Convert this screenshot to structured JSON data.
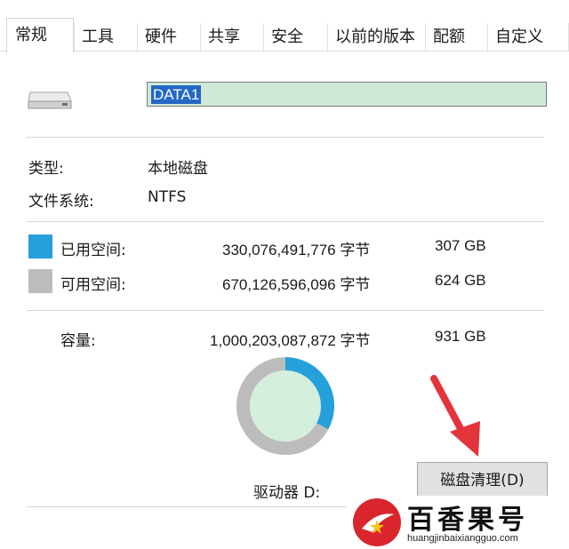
{
  "tabs": [
    {
      "label": "常规",
      "active": true
    },
    {
      "label": "工具"
    },
    {
      "label": "硬件"
    },
    {
      "label": "共享"
    },
    {
      "label": "安全"
    },
    {
      "label": "以前的版本"
    },
    {
      "label": "配额"
    },
    {
      "label": "自定义"
    }
  ],
  "drive": {
    "icon": "drive-icon",
    "name": "DATA1"
  },
  "info": {
    "type_label": "类型:",
    "type_value": "本地磁盘",
    "fs_label": "文件系统:",
    "fs_value": "NTFS"
  },
  "space": {
    "used_label": "已用空间:",
    "used_bytes": "330,076,491,776 字节",
    "used_size": "307 GB",
    "used_color": "#26a0da",
    "free_label": "可用空间:",
    "free_bytes": "670,126,596,096 字节",
    "free_size": "624 GB",
    "free_color": "#bcbcbc",
    "capacity_label": "容量:",
    "capacity_bytes": "1,000,203,087,872 字节",
    "capacity_size": "931 GB"
  },
  "chart_data": {
    "type": "pie",
    "categories": [
      "已用空间",
      "可用空间"
    ],
    "values": [
      307,
      624
    ],
    "colors": [
      "#26a0da",
      "#bcbcbc"
    ]
  },
  "drive_label": "驱动器 D:",
  "cleanup_button": "磁盘清理(D)",
  "watermark": {
    "brand": "百香果号",
    "url": "huangjinbaixiangguo.com"
  }
}
